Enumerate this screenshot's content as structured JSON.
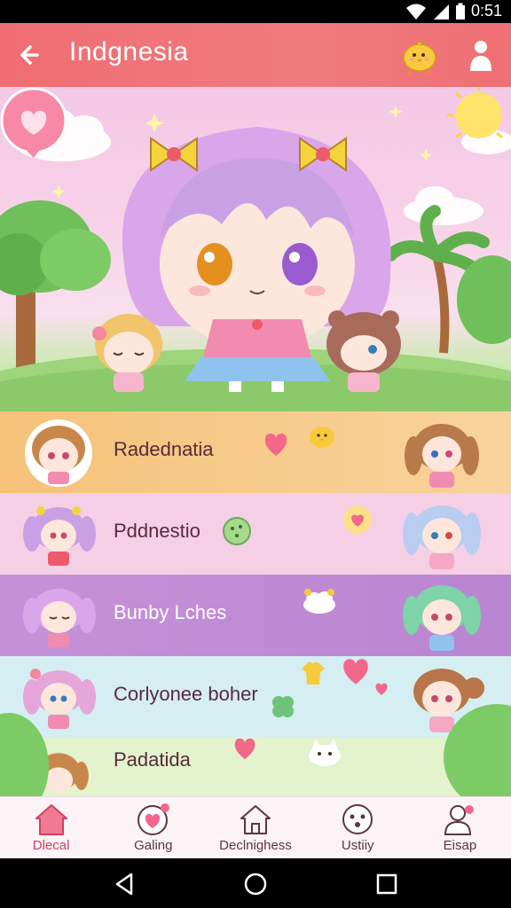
{
  "status_bar": {
    "time": "0:51",
    "icons": [
      "wifi-icon",
      "signal-icon",
      "battery-icon"
    ]
  },
  "app_bar": {
    "title": "Indgnesia",
    "icons": [
      "back-arrow-icon",
      "chick-icon",
      "profile-icon"
    ]
  },
  "list": {
    "items": [
      {
        "label": "Radednatia",
        "background": "#f7c98a"
      },
      {
        "label": "Pddnestio",
        "background": "#f5cce6"
      },
      {
        "label": "Bunby Lches",
        "background": "#c89ad8"
      },
      {
        "label": "Corlyonee boher",
        "background": "#d6eef0"
      },
      {
        "label": "Padatida",
        "background": "#dff2c8"
      }
    ]
  },
  "bottom_nav": {
    "items": [
      {
        "label": "Dlecal",
        "icon": "home-icon",
        "active": true
      },
      {
        "label": "Galing",
        "icon": "heart-icon",
        "active": false
      },
      {
        "label": "Declnighess",
        "icon": "house-outline-icon",
        "active": false
      },
      {
        "label": "Ustiiy",
        "icon": "face-icon",
        "active": false
      },
      {
        "label": "Eisap",
        "icon": "user-icon",
        "active": false
      }
    ]
  },
  "colors": {
    "app_bar": "#ef6e73",
    "accent": "#d43f63",
    "nav_background": "#fbf3f6"
  }
}
